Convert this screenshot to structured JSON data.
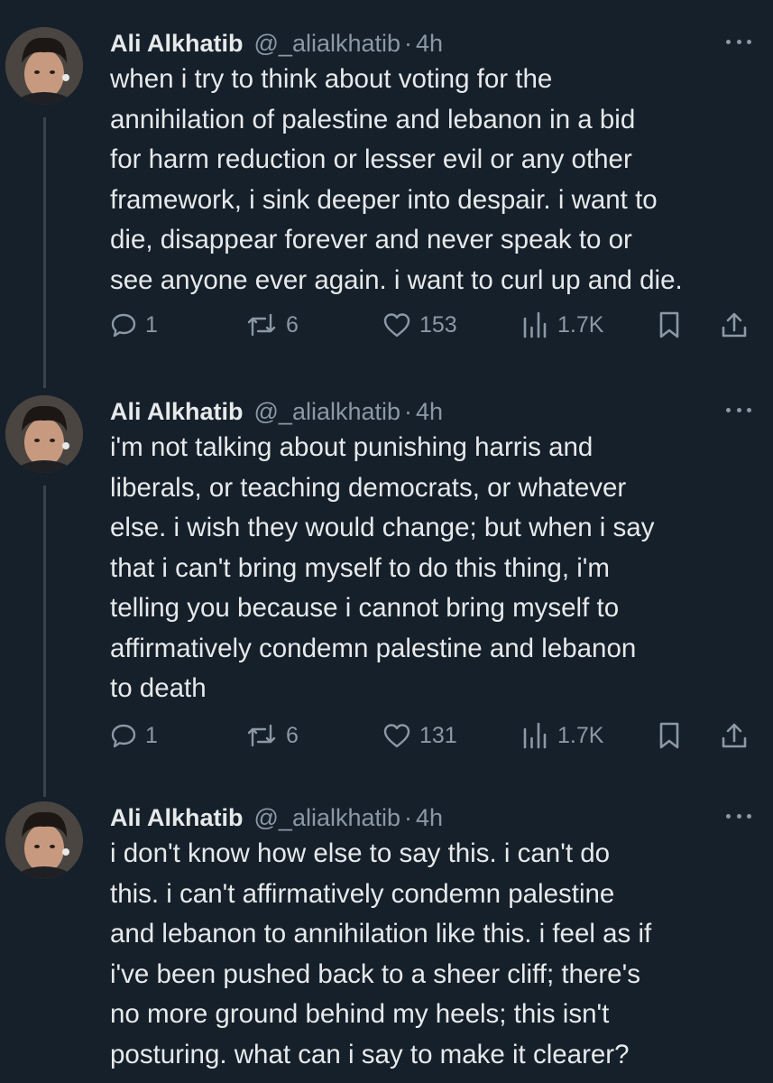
{
  "tweets": [
    {
      "name": "Ali Alkhatib",
      "handle": "@_alialkhatib",
      "separator": "·",
      "time": "4h",
      "text": "when i try to think about voting for the\nannihilation of palestine and lebanon in a bid\nfor harm reduction or lesser evil or any other\nframework, i sink deeper into despair. i want to\ndie, disappear forever and never speak to or\nsee anyone ever again. i want to curl up and die.",
      "replies": "1",
      "reposts": "6",
      "likes": "153",
      "views": "1.7K"
    },
    {
      "name": "Ali Alkhatib",
      "handle": "@_alialkhatib",
      "separator": "·",
      "time": "4h",
      "text": "i'm not talking about punishing harris and\nliberals, or teaching democrats, or whatever\nelse. i wish they would change; but when i say\nthat i can't bring myself to do this thing, i'm\ntelling you because i cannot bring myself to\naffirmatively condemn palestine and lebanon\nto death",
      "replies": "1",
      "reposts": "6",
      "likes": "131",
      "views": "1.7K"
    },
    {
      "name": "Ali Alkhatib",
      "handle": "@_alialkhatib",
      "separator": "·",
      "time": "4h",
      "text": "i don't know how else to say this. i can't do\nthis. i can't affirmatively condemn palestine\nand lebanon to annihilation like this. i feel as if\ni've been pushed back to a sheer cliff; there's\nno more ground behind my heels; this isn't\nposturing. what can i say to make it clearer?"
    }
  ],
  "icons": {
    "reply": "reply-icon",
    "repost": "repost-icon",
    "like": "heart-icon",
    "views": "views-icon",
    "bookmark": "bookmark-icon",
    "share": "share-icon",
    "more": "more-icon"
  },
  "colors": {
    "background": "#15202b",
    "text": "#e7e9ea",
    "secondary": "#8b98a5",
    "thread_line": "#38444d"
  }
}
